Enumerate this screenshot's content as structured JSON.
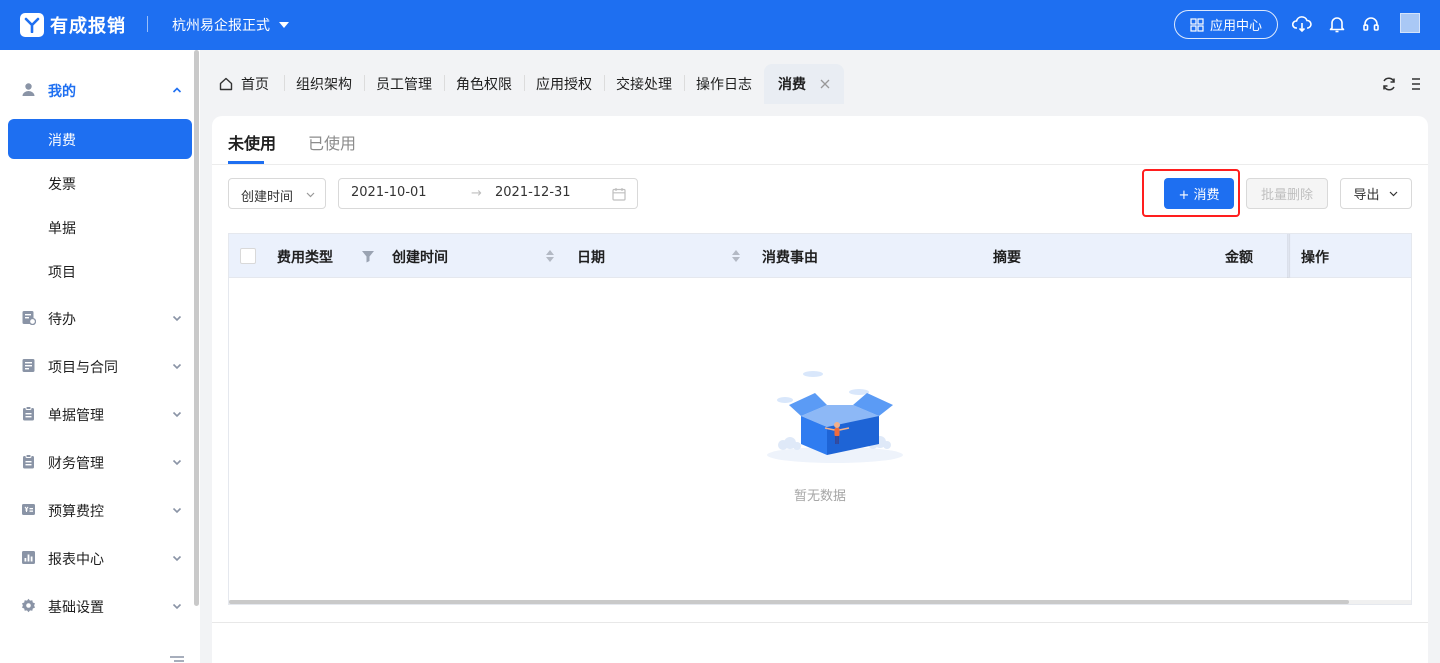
{
  "header": {
    "app_name": "有成报销",
    "company": "杭州易企报正式",
    "app_center": "应用中心",
    "brand_color": "#1e6ff1"
  },
  "sidebar": {
    "groups": [
      {
        "label": "我的",
        "icon": "user-icon",
        "expanded": true,
        "items": [
          {
            "label": "消费",
            "selected": true
          },
          {
            "label": "发票"
          },
          {
            "label": "单据"
          },
          {
            "label": "项目"
          }
        ]
      },
      {
        "label": "待办",
        "icon": "todo-icon"
      },
      {
        "label": "项目与合同",
        "icon": "contract-icon"
      },
      {
        "label": "单据管理",
        "icon": "clipboard-icon"
      },
      {
        "label": "财务管理",
        "icon": "clipboard-icon"
      },
      {
        "label": "预算费控",
        "icon": "budget-icon"
      },
      {
        "label": "报表中心",
        "icon": "chart-icon"
      },
      {
        "label": "基础设置",
        "icon": "gear-icon"
      }
    ]
  },
  "tabs": [
    {
      "label": "首页",
      "icon": "home-icon"
    },
    {
      "label": "组织架构"
    },
    {
      "label": "员工管理"
    },
    {
      "label": "角色权限"
    },
    {
      "label": "应用授权"
    },
    {
      "label": "交接处理"
    },
    {
      "label": "操作日志"
    },
    {
      "label": "消费",
      "active": true,
      "closable": true
    }
  ],
  "main": {
    "subtabs": [
      "未使用",
      "已使用"
    ],
    "filter": {
      "field_select": "创建时间",
      "date_start": "2021-10-01",
      "date_sep": "→",
      "date_end": "2021-12-31"
    },
    "actions": {
      "add": "+ 消费",
      "batch_delete": "批量删除",
      "export": "导出"
    },
    "table": {
      "columns": [
        "费用类型",
        "创建时间",
        "日期",
        "消费事由",
        "摘要",
        "金额",
        "操作"
      ],
      "rows": [],
      "empty_text": "暂无数据"
    }
  }
}
